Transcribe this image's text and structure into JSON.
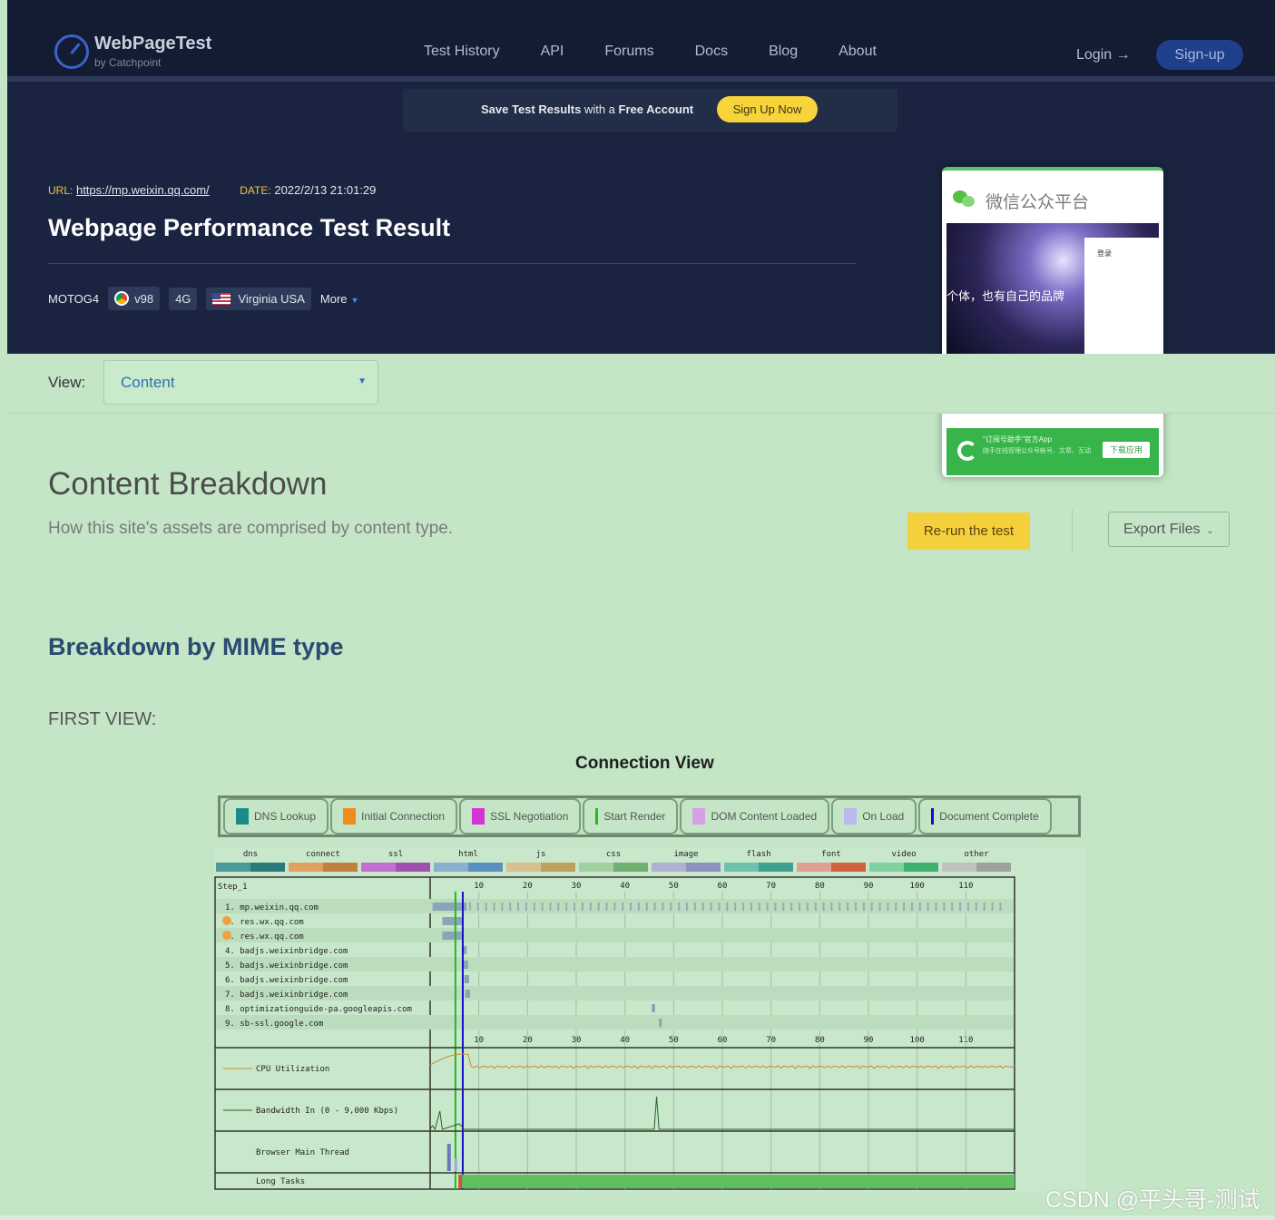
{
  "header": {
    "logo_title": "WebPageTest",
    "logo_sub": "by Catchpoint",
    "nav": [
      "Test History",
      "API",
      "Forums",
      "Docs",
      "Blog",
      "About"
    ],
    "login": "Login →",
    "signup": "Sign-up",
    "banner_pre": "Save Test Results",
    "banner_mid": " with a ",
    "banner_bold": "Free Account",
    "banner_btn": "Sign Up Now"
  },
  "result": {
    "url_label": "URL:",
    "url": "https://mp.weixin.qq.com/",
    "date_label": "DATE:",
    "date": "2022/2/13 21:01:29",
    "title": "Webpage Performance Test Result",
    "device": "MOTOG4",
    "browser": "v98",
    "network": "4G",
    "location": "Virginia USA",
    "more": "More"
  },
  "preview": {
    "title": "微信公众平台",
    "caption": "个体，也有自己的品牌",
    "login_text": "登录",
    "small_text": "微信",
    "promo_1": "\"订阅号助手\"官方App",
    "promo_2": "随手在线管理公众号帐号、文章、互动",
    "promo_btn": "下载应用"
  },
  "view": {
    "label": "View:",
    "value": "Content"
  },
  "content": {
    "heading": "Content Breakdown",
    "subheading": "How this site's assets are comprised by content type.",
    "rerun": "Re-run the test",
    "export": "Export Files",
    "mime_heading": "Breakdown by MIME type",
    "first_view": "FIRST VIEW:",
    "chart_title": "Connection View"
  },
  "legend": [
    {
      "label": "DNS Lookup",
      "color": "#1a8a8a"
    },
    {
      "label": "Initial Connection",
      "color": "#f08c1e"
    },
    {
      "label": "SSL Negotiation",
      "color": "#d633d6"
    },
    {
      "label": "Start Render",
      "color": "#22bb22"
    },
    {
      "label": "DOM Content Loaded",
      "color": "#d89ee6"
    },
    {
      "label": "On Load",
      "color": "#b9b9f0"
    },
    {
      "label": "Document Complete",
      "color": "#1010cc"
    }
  ],
  "chart_data": {
    "type": "waterfall",
    "title": "Connection View",
    "categories": [
      "dns",
      "connect",
      "ssl",
      "html",
      "js",
      "css",
      "image",
      "flash",
      "font",
      "video",
      "other"
    ],
    "category_colors": [
      [
        "#4a9a9a",
        "#2a7a7a"
      ],
      [
        "#e0a060",
        "#c08040"
      ],
      [
        "#c070d0",
        "#a050b0"
      ],
      [
        "#8ab0d0",
        "#5a90c0"
      ],
      [
        "#d8c090",
        "#c0a060"
      ],
      [
        "#a0d0a0",
        "#70b070"
      ],
      [
        "#b0b0d0",
        "#9090c0"
      ],
      [
        "#70c0b0",
        "#40a090"
      ],
      [
        "#e0a090",
        "#d06040"
      ],
      [
        "#80d0a0",
        "#40b070"
      ],
      [
        "#c0c0c0",
        "#a0a0a0"
      ]
    ],
    "step_label": "Step_1",
    "ticks": [
      10,
      20,
      30,
      40,
      50,
      60,
      70,
      80,
      90,
      100,
      110
    ],
    "requests": [
      "1. mp.weixin.qq.com",
      "2. res.wx.qq.com",
      "3. res.wx.qq.com",
      "4. badjs.weixinbridge.com",
      "5. badjs.weixinbridge.com",
      "6. badjs.weixinbridge.com",
      "7. badjs.weixinbridge.com",
      "8. optimizationguide-pa.googleapis.com",
      "9. sb-ssl.google.com"
    ],
    "request_times": [
      [
        0.5,
        7.5
      ],
      [
        2.5,
        6.5
      ],
      [
        2.5,
        6.5
      ],
      [
        6.5,
        7.5
      ],
      [
        6.8,
        7.8
      ],
      [
        7.0,
        8.0
      ],
      [
        7.2,
        8.2
      ],
      [
        45.5,
        46.2
      ],
      [
        47.0,
        47.4
      ]
    ],
    "start_render": 5.2,
    "document_complete": 6.7,
    "graphs": [
      "CPU Utilization",
      "Bandwidth In (0 - 9,000 Kbps)",
      "Browser Main Thread",
      "Long Tasks"
    ],
    "xlim": [
      0,
      120
    ]
  }
}
